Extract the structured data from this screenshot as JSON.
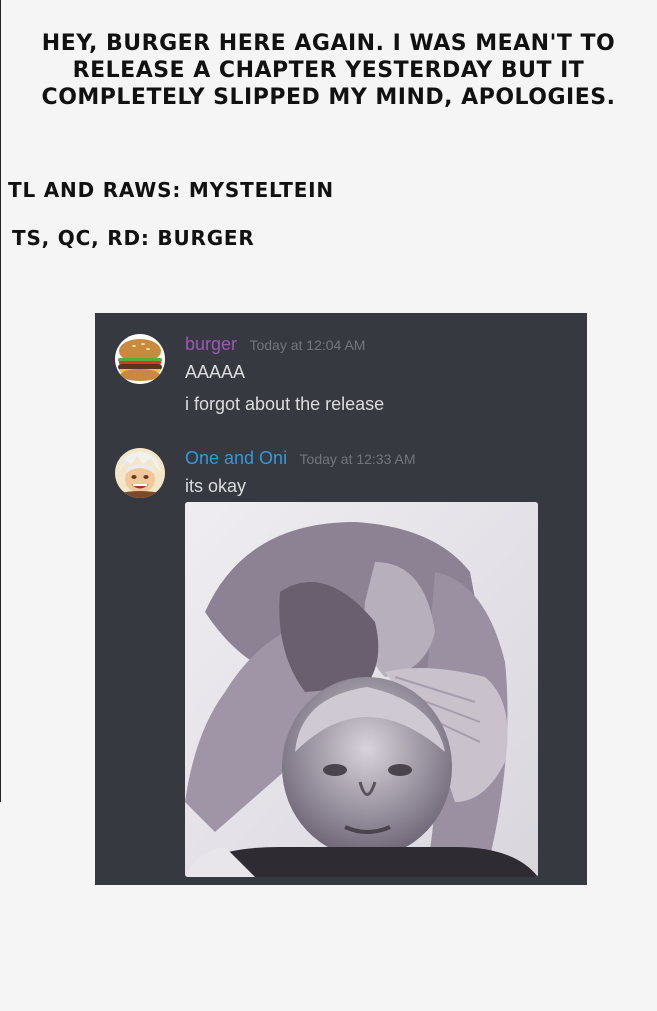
{
  "announcement": {
    "text": "Hey, Burger here again. I was mean't to release a chapter yesterday but it completely slipped my mind, apologies."
  },
  "credits": {
    "tl_raws": "TL and Raws: Mysteltein",
    "ts_qc_rd": "TS, QC, RD: Burger"
  },
  "chat": {
    "colors": {
      "background": "#36393f",
      "username_burger": "#9b59b6",
      "username_oni": "#3498db",
      "timestamp": "#72767d",
      "message_text": "#dcddde"
    },
    "messages": [
      {
        "avatar_icon": "burger-avatar-icon",
        "username": "burger",
        "timestamp": "Today at 12:04 AM",
        "lines": [
          "AAAAA",
          "i forgot about the release"
        ]
      },
      {
        "avatar_icon": "anime-character-avatar-icon",
        "username": "One and Oni",
        "timestamp": "Today at 12:33 AM",
        "lines": [
          "its okay"
        ],
        "attachment_icon": "meme-image-icon"
      }
    ]
  }
}
